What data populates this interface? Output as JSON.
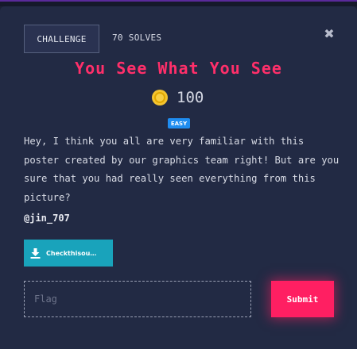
{
  "colors": {
    "background": "#1c2135",
    "modal": "#222a44",
    "title": "#ff2f6a",
    "badge": "#1f8df0",
    "file_button": "#19a3bb",
    "submit": "#ff1f62"
  },
  "tabs": {
    "challenge_label": "CHALLENGE",
    "solves_label": "70 SOLVES"
  },
  "close_icon": "close-icon",
  "challenge": {
    "title": "You See What You See",
    "points": "100",
    "points_icon": "coin-icon",
    "difficulty": "EASY",
    "description": "Hey, I think you all are very familiar with this poster created by our graphics team right! But are you sure that you had really seen everything from this picture?",
    "author": "@jin_707"
  },
  "file": {
    "icon": "download-icon",
    "label": "Checkthisou…"
  },
  "form": {
    "flag_placeholder": "Flag",
    "flag_value": "",
    "submit_label": "Submit"
  }
}
